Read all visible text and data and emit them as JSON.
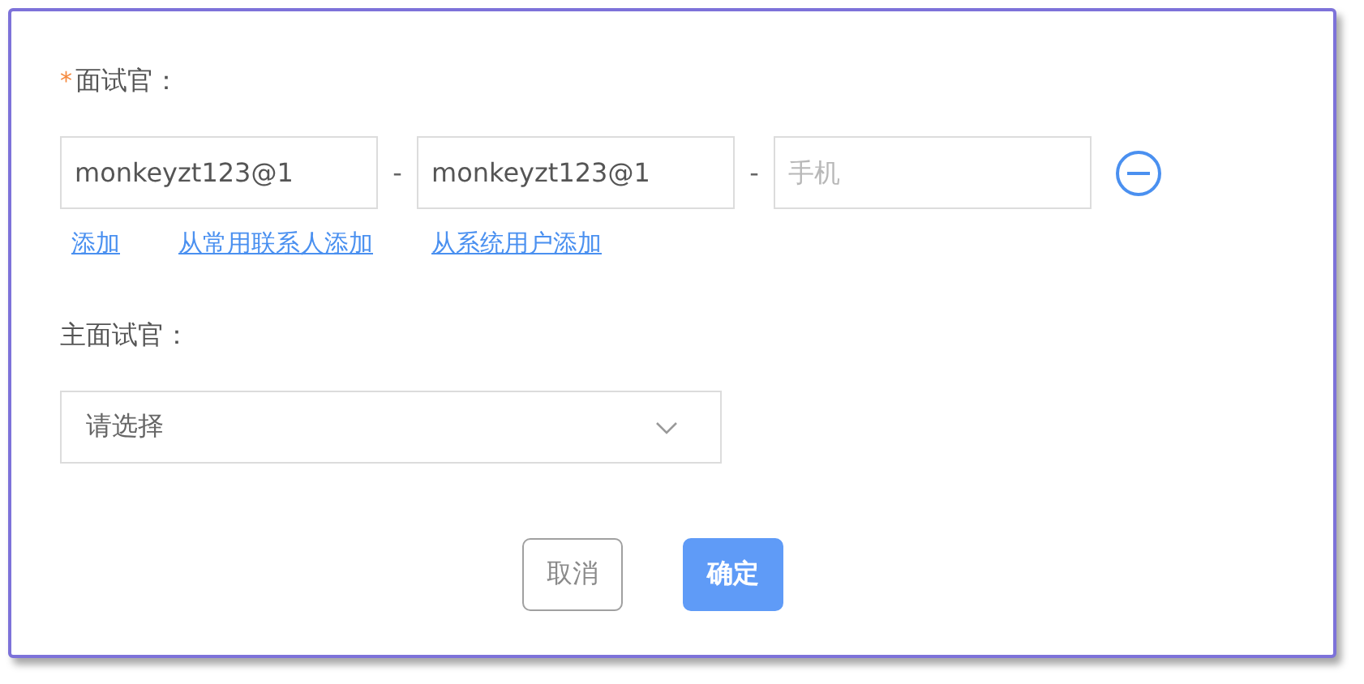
{
  "interviewers": {
    "label": "面试官：",
    "required_mark": "*",
    "fields": [
      {
        "value": "monkeyzt123@1"
      },
      {
        "value": "monkeyzt123@1"
      },
      {
        "placeholder": "手机"
      }
    ],
    "separators": [
      "-",
      "-"
    ],
    "links": [
      "添加",
      "从常用联系人添加",
      "从系统用户添加"
    ]
  },
  "main_interviewer": {
    "label": "主面试官：",
    "select": {
      "placeholder": "请选择"
    }
  },
  "buttons": [
    {
      "label": "取消",
      "kind": "secondary"
    },
    {
      "label": "确定",
      "kind": "primary"
    }
  ]
}
